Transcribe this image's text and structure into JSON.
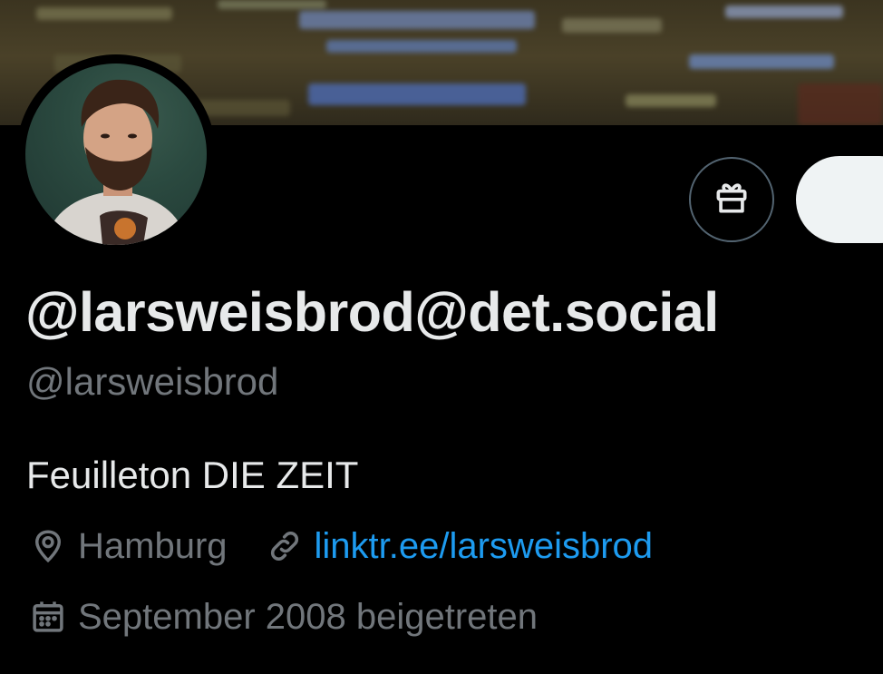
{
  "profile": {
    "display_name": "@larsweisbrod@det.social",
    "handle": "@larsweisbrod",
    "bio": "Feuilleton DIE ZEIT",
    "location": "Hamburg",
    "website": "linktr.ee/larsweisbrod",
    "joined": "September 2008 beigetreten"
  },
  "icons": {
    "gift": "gift-icon",
    "location": "location-pin-icon",
    "link": "link-icon",
    "calendar": "calendar-icon"
  },
  "colors": {
    "background": "#000000",
    "primary_text": "#e7e9ea",
    "secondary_text": "#71767b",
    "link": "#1d9bf0",
    "button_border": "#536471",
    "follow_button": "#eff3f4"
  }
}
